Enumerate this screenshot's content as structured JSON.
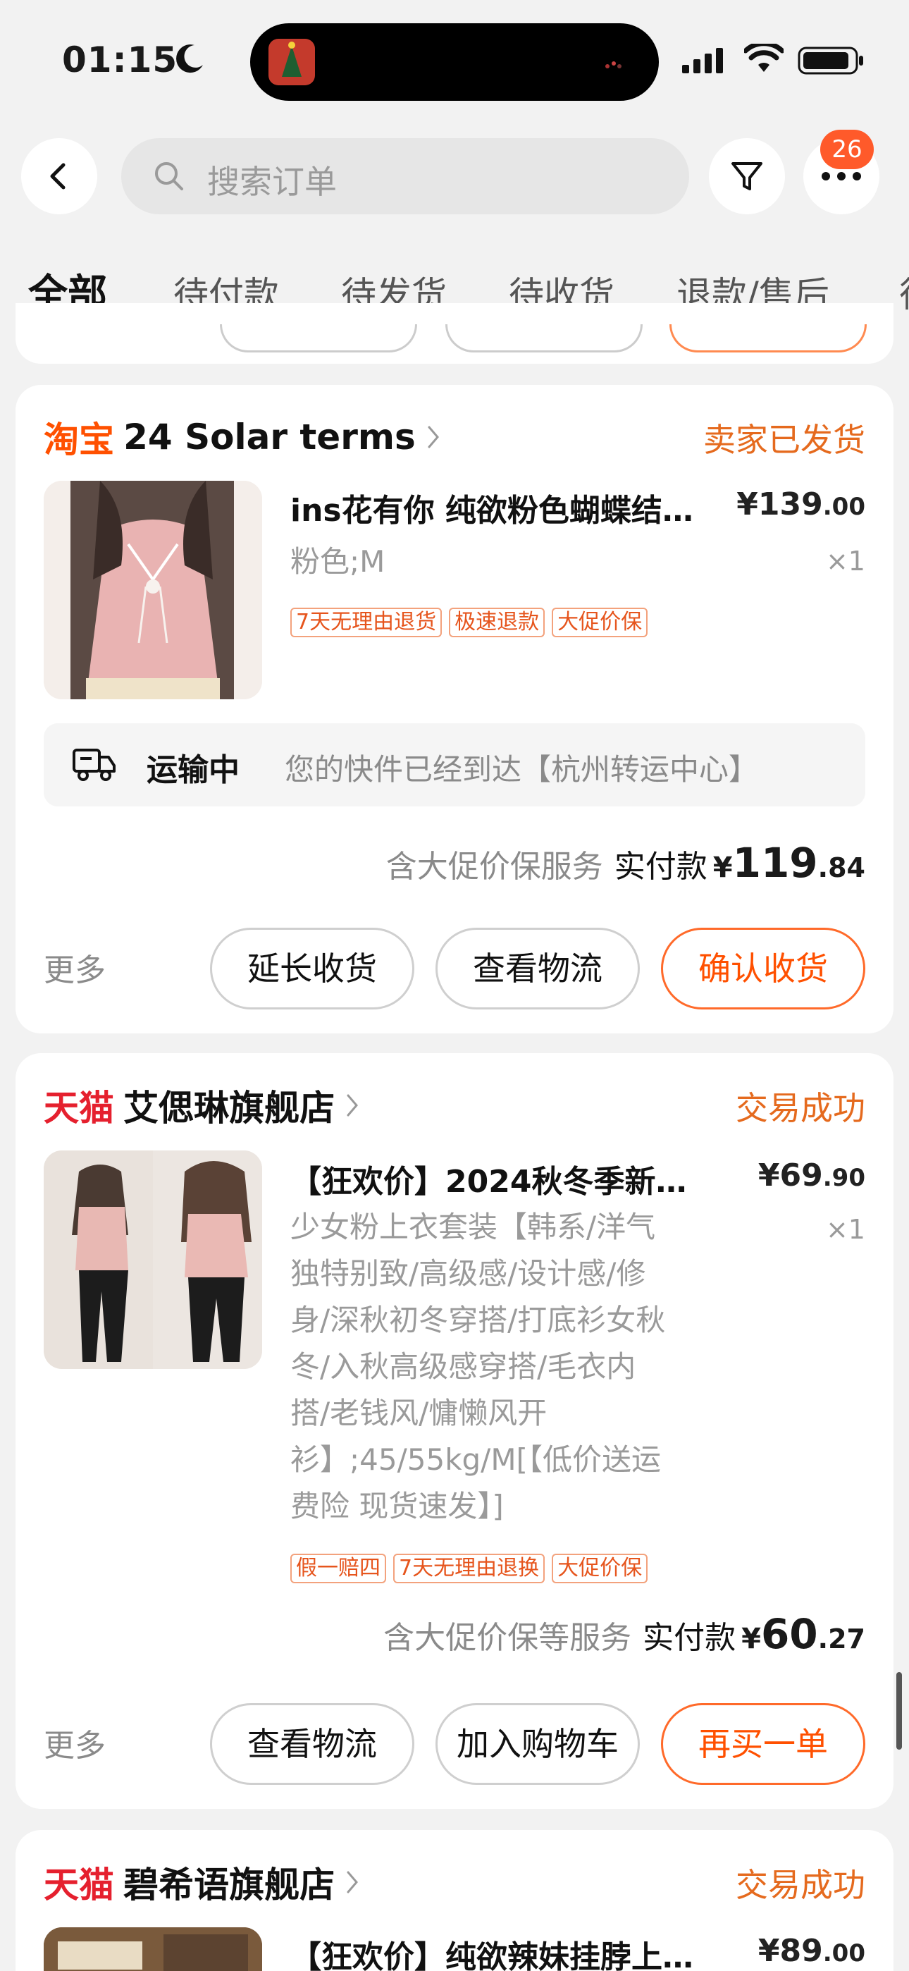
{
  "status_bar": {
    "time": "01:15"
  },
  "header": {
    "search_placeholder": "搜索订单",
    "notification_count": "26"
  },
  "tabs": [
    {
      "label": "全部",
      "active": true
    },
    {
      "label": "待付款",
      "active": false
    },
    {
      "label": "待发货",
      "active": false
    },
    {
      "label": "待收货",
      "active": false
    },
    {
      "label": "退款/售后",
      "active": false
    },
    {
      "label": "待",
      "active": false
    }
  ],
  "orders": [
    {
      "platform": "淘宝",
      "shop_name": "24 Solar terms",
      "status": "卖家已发货",
      "item": {
        "title": "ins花有你 纯欲粉色蝴蝶结…",
        "price_yen": "¥",
        "price_int": "139",
        "price_dec": ".00",
        "sku": "粉色;M",
        "qty": "×1",
        "tags": [
          "7天无理由退货",
          "极速退款",
          "大促价保"
        ]
      },
      "logistics": {
        "label": "运输中",
        "text": "您的快件已经到达【杭州转运中心】"
      },
      "payment": {
        "note": "含大促价保服务",
        "label": "实付款",
        "yen": "¥",
        "int": "119",
        "dec": ".84"
      },
      "more": "更多",
      "buttons": [
        "延长收货",
        "查看物流",
        "确认收货"
      ]
    },
    {
      "platform": "天猫",
      "shop_name": "艾偲琳旗舰店",
      "status": "交易成功",
      "item": {
        "title": "【狂欢价】2024秋冬季新…",
        "price_yen": "¥",
        "price_int": "69",
        "price_dec": ".90",
        "sku_lines": [
          "少女粉上衣套装【韩系/洋气",
          "独特别致/高级感/设计感/修",
          "身/深秋初冬穿搭/打底衫女秋",
          "冬/入秋高级感穿搭/毛衣内",
          "搭/老钱风/慵懒风开",
          "衫】;45/55kg/M[【低价送运",
          "费险 现货速发】]"
        ],
        "qty": "×1",
        "tags": [
          "假一赔四",
          "7天无理由退换",
          "大促价保"
        ]
      },
      "payment": {
        "note": "含大促价保等服务",
        "label": "实付款",
        "yen": "¥",
        "int": "60",
        "dec": ".27"
      },
      "more": "更多",
      "buttons": [
        "查看物流",
        "加入购物车",
        "再买一单"
      ]
    },
    {
      "platform": "天猫",
      "shop_name": "碧希语旗舰店",
      "status": "交易成功",
      "item": {
        "title": "【狂欢价】纯欲辣妹挂脖上…",
        "price_yen": "¥",
        "price_int": "89",
        "price_dec": ".00"
      }
    }
  ],
  "colors": {
    "accent": "#ff5000",
    "tmall_red": "#e5202e",
    "status_orange": "#e56a1e"
  }
}
